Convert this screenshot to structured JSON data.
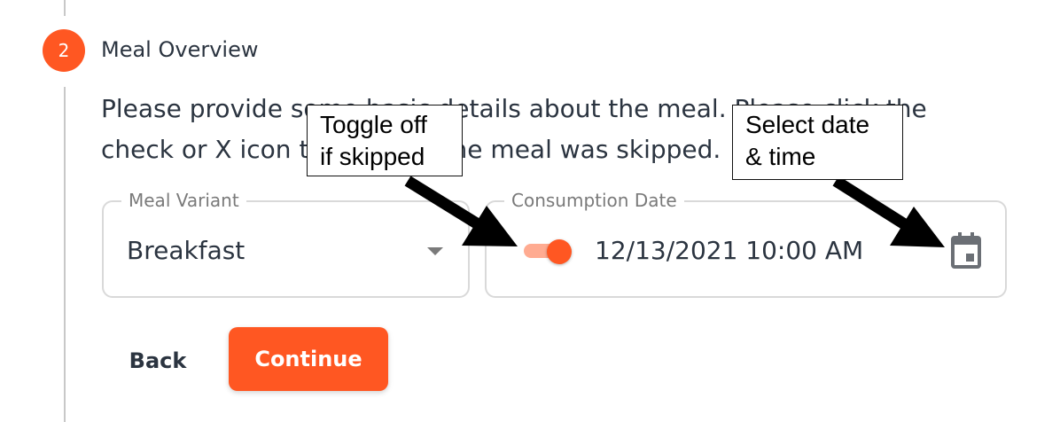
{
  "step": {
    "number": "2",
    "title": "Meal Overview",
    "description": "Please provide some basic details about the meal. Please click the check or X icon to toggle if the meal was skipped."
  },
  "meal_variant": {
    "label": "Meal Variant",
    "value": "Breakfast",
    "icon": "chevron-down-icon"
  },
  "consumption_date": {
    "label": "Consumption Date",
    "value": "12/13/2021 10:00 AM",
    "toggle_state": "on",
    "icon": "calendar-icon"
  },
  "buttons": {
    "back": "Back",
    "continue": "Continue"
  },
  "annotations": {
    "toggle_callout": "Toggle off\nif skipped",
    "date_callout": "Select date\n& time"
  },
  "colors": {
    "accent": "#ff5722",
    "accent_light": "#ffab91",
    "text": "#2b3440",
    "border": "#d9d9d9"
  }
}
